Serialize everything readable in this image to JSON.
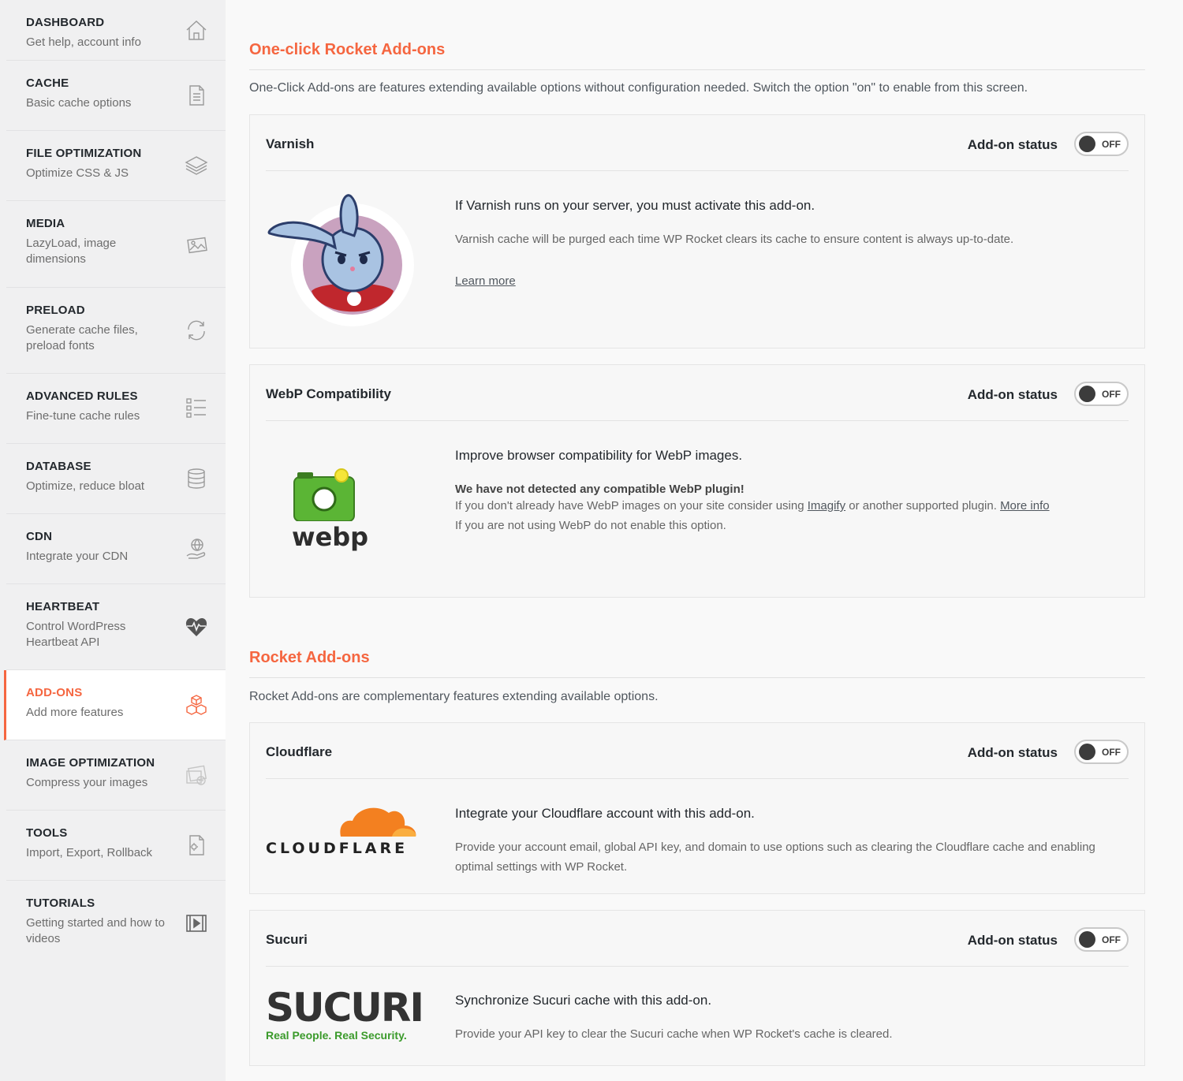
{
  "sidebar": {
    "items": [
      {
        "title": "DASHBOARD",
        "subtitle": "Get help, account info",
        "icon": "home-icon"
      },
      {
        "title": "CACHE",
        "subtitle": "Basic cache options",
        "icon": "document-icon"
      },
      {
        "title": "FILE OPTIMIZATION",
        "subtitle": "Optimize CSS & JS",
        "icon": "layers-icon"
      },
      {
        "title": "MEDIA",
        "subtitle": "LazyLoad, image dimensions",
        "icon": "image-icon"
      },
      {
        "title": "PRELOAD",
        "subtitle": "Generate cache files, preload fonts",
        "icon": "refresh-icon"
      },
      {
        "title": "ADVANCED RULES",
        "subtitle": "Fine-tune cache rules",
        "icon": "list-icon"
      },
      {
        "title": "DATABASE",
        "subtitle": "Optimize, reduce bloat",
        "icon": "database-icon"
      },
      {
        "title": "CDN",
        "subtitle": "Integrate your CDN",
        "icon": "globe-hand-icon"
      },
      {
        "title": "HEARTBEAT",
        "subtitle": "Control WordPress Heartbeat API",
        "icon": "heartbeat-icon"
      },
      {
        "title": "ADD-ONS",
        "subtitle": "Add more features",
        "icon": "cubes-icon",
        "active": true
      },
      {
        "title": "IMAGE OPTIMIZATION",
        "subtitle": "Compress your images",
        "icon": "imagify-icon"
      },
      {
        "title": "TOOLS",
        "subtitle": "Import, Export, Rollback",
        "icon": "tools-icon"
      },
      {
        "title": "TUTORIALS",
        "subtitle": "Getting started and how to videos",
        "icon": "video-icon"
      }
    ],
    "accent_color": "#f56640"
  },
  "one_click": {
    "title": "One-click Rocket Add-ons",
    "description": "One-Click Add-ons are features extending available options without configuration needed. Switch the option \"on\" to enable from this screen.",
    "varnish": {
      "title": "Varnish",
      "status_label": "Add-on status",
      "toggle": "OFF",
      "heading": "If Varnish runs on your server, you must activate this add-on.",
      "text": "Varnish cache will be purged each time WP Rocket clears its cache to ensure content is always up-to-date.",
      "link": "Learn more"
    },
    "webp": {
      "title": "WebP Compatibility",
      "status_label": "Add-on status",
      "toggle": "OFF",
      "heading": "Improve browser compatibility for WebP images.",
      "warning": "We have not detected any compatible WebP plugin!",
      "text1_a": "If you don't already have WebP images on your site consider using ",
      "link_imagify": "Imagify",
      "text1_b": " or another supported plugin. ",
      "link_more": "More info",
      "text2": "If you are not using WebP do not enable this option.",
      "logo_text": "webp"
    }
  },
  "rocket": {
    "title": "Rocket Add-ons",
    "description": "Rocket Add-ons are complementary features extending available options.",
    "cloudflare": {
      "title": "Cloudflare",
      "status_label": "Add-on status",
      "toggle": "OFF",
      "heading": "Integrate your Cloudflare account with this add-on.",
      "text": "Provide your account email, global API key, and domain to use options such as clearing the Cloudflare cache and enabling optimal settings with WP Rocket.",
      "logo_text": "CLOUDFLARE"
    },
    "sucuri": {
      "title": "Sucuri",
      "status_label": "Add-on status",
      "toggle": "OFF",
      "heading": "Synchronize Sucuri cache with this add-on.",
      "text": "Provide your API key to clear the Sucuri cache when WP Rocket's cache is cleared.",
      "logo_text": "SUCURI",
      "logo_tagline": "Real People. Real Security."
    }
  }
}
